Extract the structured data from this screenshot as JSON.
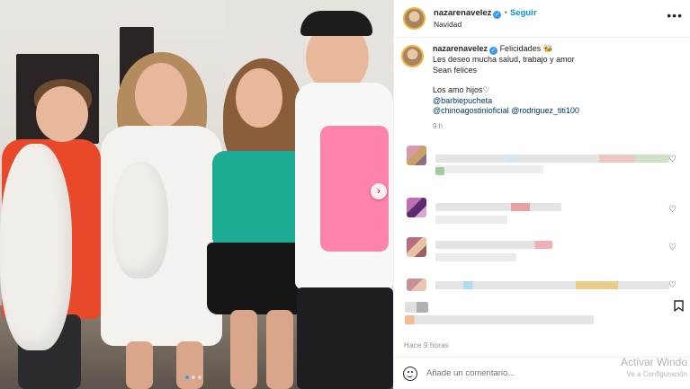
{
  "post": {
    "username": "nazarenavelez",
    "follow_label": "Seguir",
    "separator": "•",
    "location": "Navidad",
    "more_icon": "more-horizontal-icon"
  },
  "caption": {
    "username": "nazarenavelez",
    "lines": [
      "Felicidades 🐝",
      "Les deseo mucha salud, trabajo y amor",
      "Sean felices",
      "",
      "Los amo hijos♡"
    ],
    "mentions": [
      "@barbiepucheta",
      "@chinoagostinioficial",
      "@rodriguez_titi100"
    ],
    "time": "9 h"
  },
  "footer": {
    "time_ago": "Hace 9 horas",
    "comment_placeholder": "Añade un comentario...",
    "watermark_line1": "Activar Windo",
    "watermark_line2": "Ve a Configuración"
  },
  "colors": {
    "accent": "#0095f6",
    "verified": "#3897f0",
    "text": "#262626",
    "muted": "#8e8e8e",
    "mention": "#00376b"
  }
}
